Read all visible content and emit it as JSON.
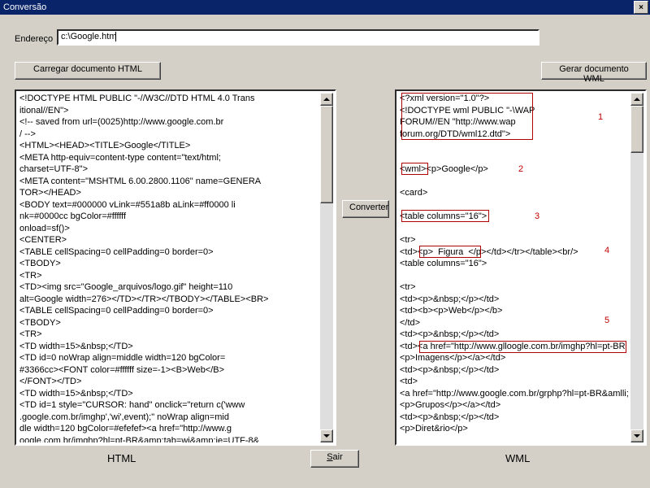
{
  "window": {
    "title": "Conversão"
  },
  "address": {
    "label": "Endereço",
    "value": "c:\\Google.htm"
  },
  "buttons": {
    "load": "Carregar documento HTML",
    "generate": "Gerar documento WML",
    "convert": "Converter",
    "exit_pre": "",
    "exit_u": "S",
    "exit_post": "air"
  },
  "labels": {
    "html": "HTML",
    "wml": "WML"
  },
  "html_content": "<!DOCTYPE HTML PUBLIC \"-//W3C//DTD HTML 4.0 Trans\nitional//EN\">\n<!-- saved from url=(0025)http://www.google.com.br\n/ -->\n<HTML><HEAD><TITLE>Google</TITLE>\n<META http-equiv=content-type content=\"text/html;\ncharset=UTF-8\">\n<META content=\"MSHTML 6.00.2800.1106\" name=GENERA\nTOR></HEAD>\n<BODY text=#000000 vLink=#551a8b aLink=#ff0000 li\nnk=#0000cc bgColor=#ffffff\nonload=sf()>\n<CENTER>\n<TABLE cellSpacing=0 cellPadding=0 border=0>\n<TBODY>\n<TR>\n<TD><img src=\"Google_arquivos/logo.gif\" height=110\nalt=Google width=276></TD></TR></TBODY></TABLE><BR>\n<TABLE cellSpacing=0 cellPadding=0 border=0>\n<TBODY>\n<TR>\n<TD width=15>&nbsp;</TD>\n<TD id=0 noWrap align=middle width=120 bgColor=\n#3366cc><FONT color=#ffffff size=-1><B>Web</B>\n</FONT></TD>\n<TD width=15>&nbsp;</TD>\n<TD id=1 style=\"CURSOR: hand\" onclick=\"return c('www\n.google.com.br/imghp','wi',event);\" noWrap align=mid\ndle width=120 bgColor=#efefef><a href=\"http://www.g\noogle.com.br/imghp?hl=pt-BR&amp;tab=wi&amp;ie=UTF-8&",
  "wml_content": "<?xml version=\"1.0\"?>\n<!DOCTYPE wml PUBLIC \"-\\WAP\nFORUM//EN \"http://www.wap\nforum.org/DTD/wml12.dtd\">\n\n\n<wml><p>Google</p>\n\n<card>\n\n<table columns=\"16\">\n\n<tr>\n<td><p>  Figura  </p></td></tr></table><br/>\n<table columns=\"16\">\n\n<tr>\n<td><p>&nbsp;</p></td>\n<td><b><p>Web</p></b>\n</td>\n<td><p>&nbsp;</p></td>\n<td><a href=\"http://www.glloogle.com.br/imghp?hl=pt-BR\n<p>Imagens</p></a></td>\n<td><p>&nbsp;</p></td>\n<td>\n<a href=\"http://www.google.com.br/grphp?hl=pt-BR&amlli;\n<p>Grupos</p></a></td>\n<td><p>&nbsp;</p></td>\n<p>Diret&rio</p>",
  "annotations": {
    "n1": "1",
    "n2": "2",
    "n3": "3",
    "n4": "4",
    "n5": "5"
  }
}
